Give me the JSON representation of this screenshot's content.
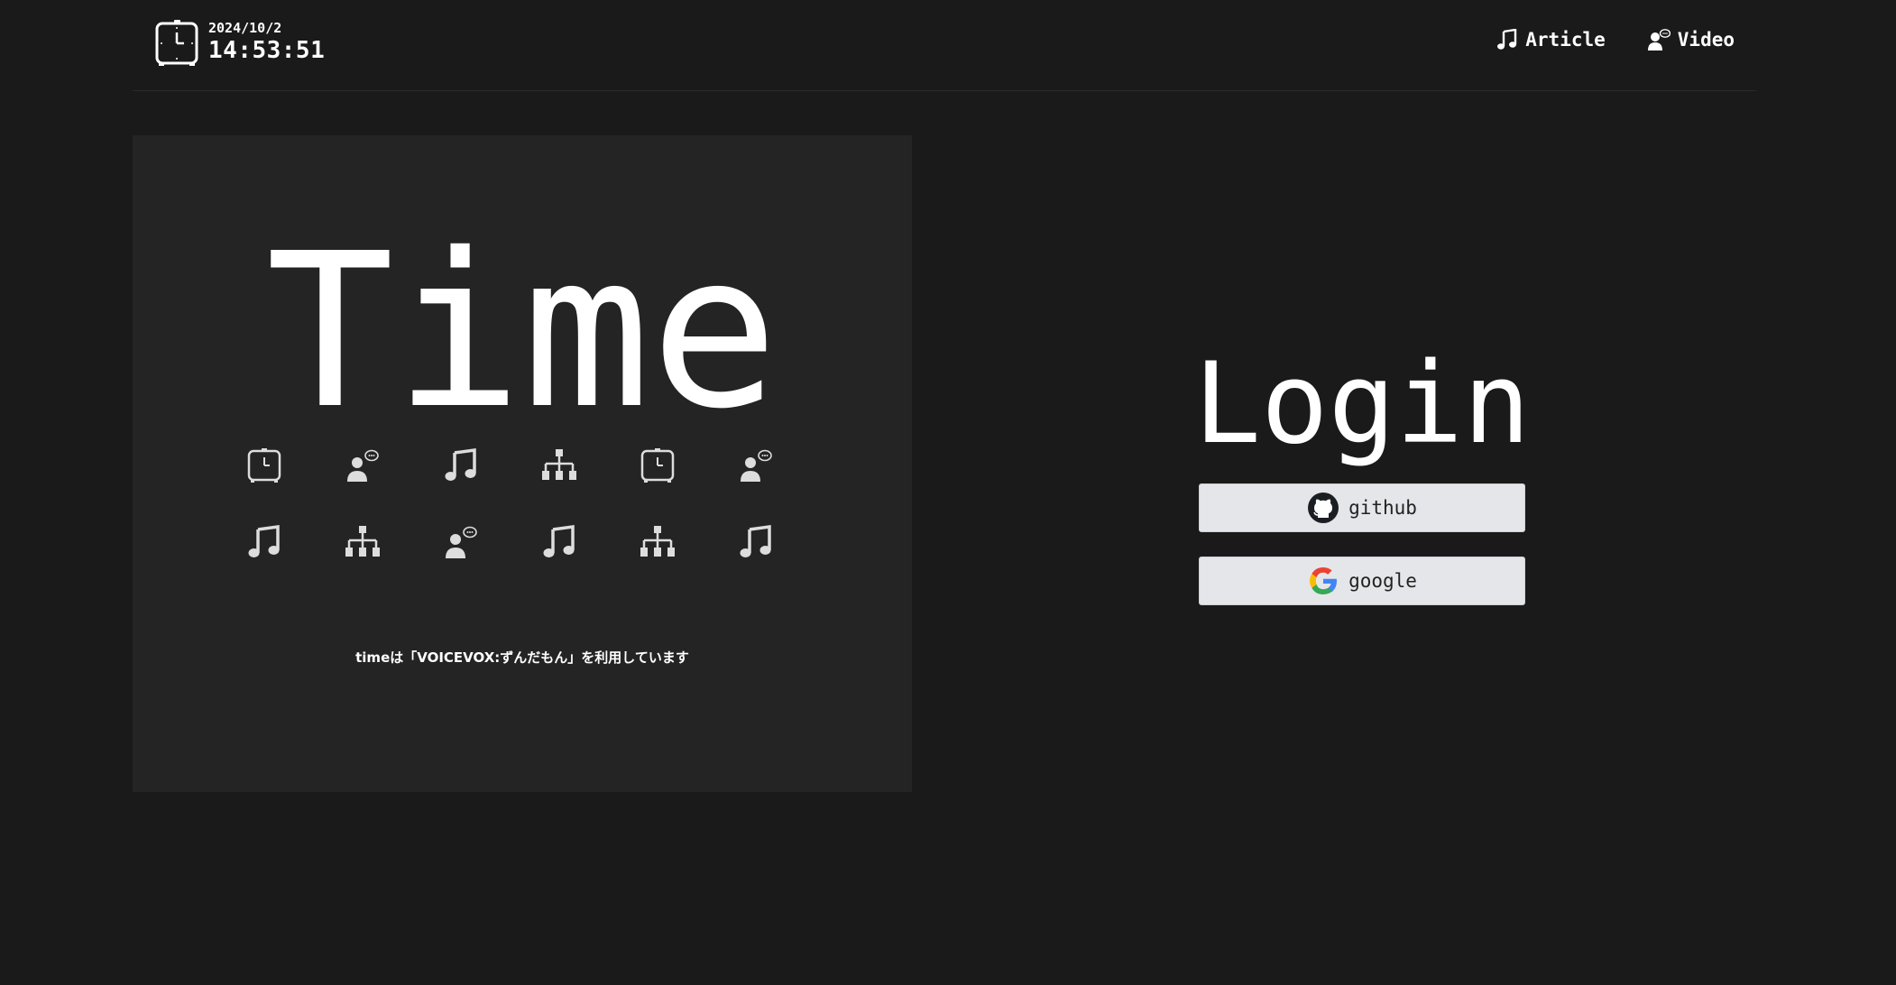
{
  "header": {
    "date": "2024/10/2",
    "time": "14:53:51",
    "nav": [
      {
        "label": "Article",
        "icon": "music-note-icon"
      },
      {
        "label": "Video",
        "icon": "speaking-person-icon"
      }
    ]
  },
  "hero": {
    "title": "Time",
    "icons": [
      "clock-icon",
      "speaking-person-icon",
      "music-note-icon",
      "sitemap-icon",
      "clock-icon",
      "speaking-person-icon",
      "music-note-icon",
      "sitemap-icon",
      "speaking-person-icon",
      "music-note-icon",
      "sitemap-icon",
      "music-note-icon"
    ],
    "credit": "timeは「VOICEVOX:ずんだもん」を利用しています"
  },
  "login": {
    "title": "Login",
    "github_label": "github",
    "google_label": "google"
  },
  "colors": {
    "background": "#1a1a1a",
    "panel": "#242424",
    "button": "#e5e6e9"
  }
}
